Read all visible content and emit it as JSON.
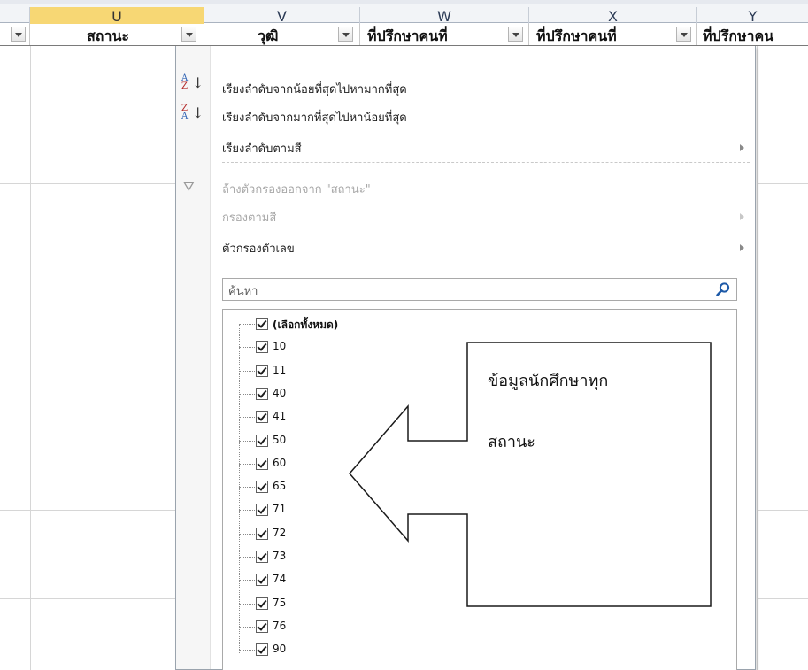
{
  "columns": {
    "letters": [
      "U",
      "V",
      "W",
      "X",
      "Y"
    ],
    "selected": "U"
  },
  "header_row": {
    "cells": [
      {
        "label": ""
      },
      {
        "label": "สถานะ"
      },
      {
        "label": "วุฒิ"
      },
      {
        "label": "ที่ปรึกษาคนที่"
      },
      {
        "label": "ที่ปรึกษาคนที่"
      },
      {
        "label": "ที่ปรึกษาคน"
      }
    ]
  },
  "filter_menu": {
    "sort_asc": "เรียงลำดับจากน้อยที่สุดไปหามากที่สุด",
    "sort_desc": "เรียงลำดับจากมากที่สุดไปหาน้อยที่สุด",
    "sort_by_color": "เรียงลำดับตามสี",
    "clear_filter": "ล้างตัวกรองออกจาก \"สถานะ\"",
    "filter_by_color": "กรองตามสี",
    "number_filters": "ตัวกรองตัวเลข",
    "search_placeholder": "ค้นหา",
    "select_all": "(เลือกทั้งหมด)",
    "values": [
      "10",
      "11",
      "40",
      "41",
      "50",
      "60",
      "65",
      "71",
      "72",
      "73",
      "74",
      "75",
      "76",
      "90"
    ]
  },
  "callout": {
    "line1": "ข้อมูลนักศึกษาทุก",
    "line2": "สถานะ"
  },
  "colors": {
    "selected_column": "#f7d774",
    "accent_search": "#1e5aa8"
  }
}
